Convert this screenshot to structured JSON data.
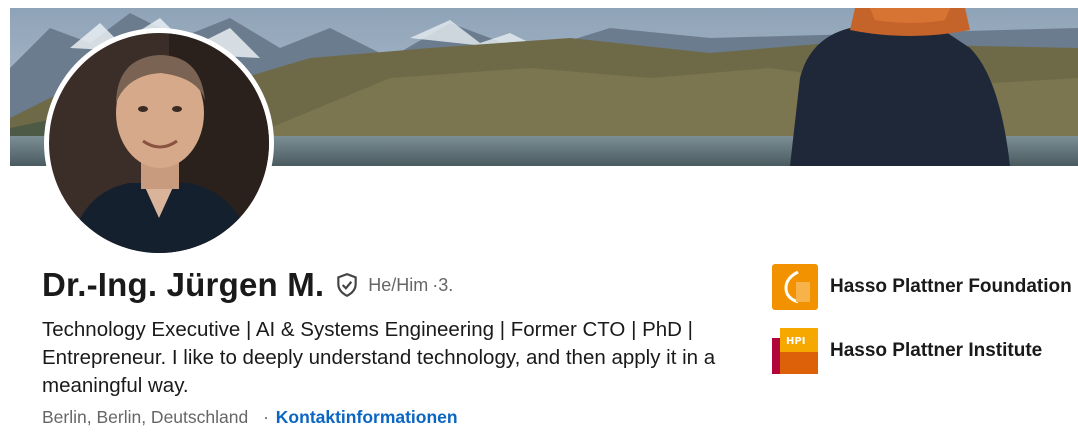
{
  "profile": {
    "name": "Dr.-Ing. Jürgen M.",
    "pronouns": "He/Him",
    "degree": "·3.",
    "headline": "Technology Executive | AI & Systems Engineering | Former CTO | PhD | Entrepreneur. I like to deeply understand technology, and then apply it in a meaningful way.",
    "location": "Berlin, Berlin, Deutschland",
    "separator": "·",
    "contact_link": "Kontaktinformationen",
    "verified_icon": "shield-check-icon"
  },
  "organizations": [
    {
      "name": "Hasso Plattner Foundation",
      "logo": "hpf-logo",
      "color": "#f39200"
    },
    {
      "name": "Hasso Plattner Institute",
      "logo": "hpi-logo",
      "logo_text": "HPI",
      "color": "#b1063a"
    }
  ],
  "colors": {
    "link": "#0a66c2",
    "text": "#1a1a1a",
    "muted": "#666666"
  }
}
